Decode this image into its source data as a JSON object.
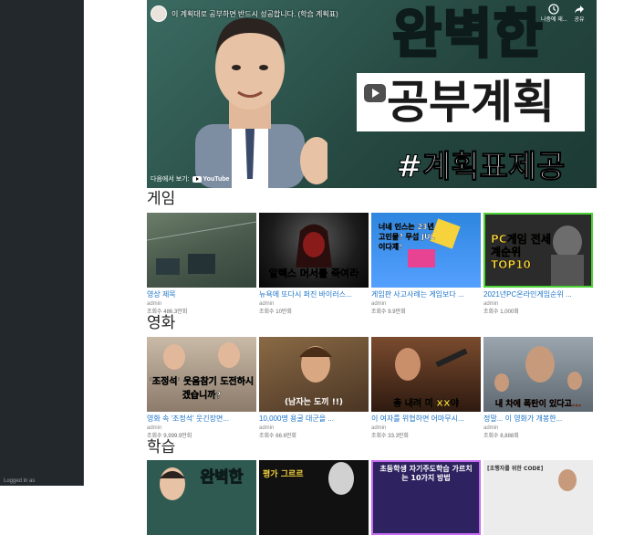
{
  "sidebar": {
    "logged_label": "Logged in as"
  },
  "video": {
    "title": "이 계획대로 공부하면 반드시 성공합니다. (학습 계획표)",
    "share1": "나중에 재...",
    "share2": "공유",
    "headline1": "완벽한",
    "headline2": "공부계획",
    "headline3": "#계획표제공",
    "watch_on": "다음에서 보기:",
    "yt": "YouTube"
  },
  "sections": [
    {
      "title": "게임",
      "cards": [
        {
          "title": "영상 제목",
          "author": "admin",
          "views": "조회수 486.3만회",
          "thumb_text": ""
        },
        {
          "title": "뉴욕에 또다시 퍼진 바이러스...",
          "author": "admin",
          "views": "조회수 10만회",
          "thumb_text": "알렉스 머서를 죽여라"
        },
        {
          "title": "게임판 사고사례는 게임보다 ...",
          "author": "admin",
          "views": "조회수 9.9만회",
          "thumb_text": "너네 인스는 23년 고인물? 무섭 JUL 이다제!"
        },
        {
          "title": "2021년PC온라인게임순위 ...",
          "author": "admin",
          "views": "조회수 1,000회",
          "thumb_text": "PC게임 전세계순위 TOP10"
        }
      ]
    },
    {
      "title": "영화",
      "cards": [
        {
          "title": "영화 속 '조정석' 웃긴장면...",
          "author": "admin",
          "views": "조회수 9,999.9만회",
          "thumb_text": "'조정석' 웃음참기 도전하시겠습니까?"
        },
        {
          "title": "10,000명 용굴 대군을 ...",
          "author": "admin",
          "views": "조회수 66.6만회",
          "thumb_text": "(남자는 도끼 !!)"
        },
        {
          "title": "이 여자를 위협하면 어마무시...",
          "author": "admin",
          "views": "조회수 33.3만회",
          "thumb_text": "총 내려 미 XX야"
        },
        {
          "title": "정말... 이 영화가 개봉한...",
          "author": "admin",
          "views": "조회수 8,888회",
          "thumb_text": "내 차에 폭탄이 있다고..."
        }
      ]
    },
    {
      "title": "학습",
      "cards": [
        {
          "title": "",
          "author": "",
          "views": "",
          "thumb_text": "완벽한"
        },
        {
          "title": "",
          "author": "",
          "views": "",
          "thumb_text": "평가 그르르"
        },
        {
          "title": "",
          "author": "",
          "views": "",
          "thumb_text": "초등학생 자기주도학습 가르치는 10가지 방법"
        },
        {
          "title": "",
          "author": "",
          "views": "",
          "thumb_text": "[초행자를 위한 CODE]"
        }
      ]
    }
  ]
}
